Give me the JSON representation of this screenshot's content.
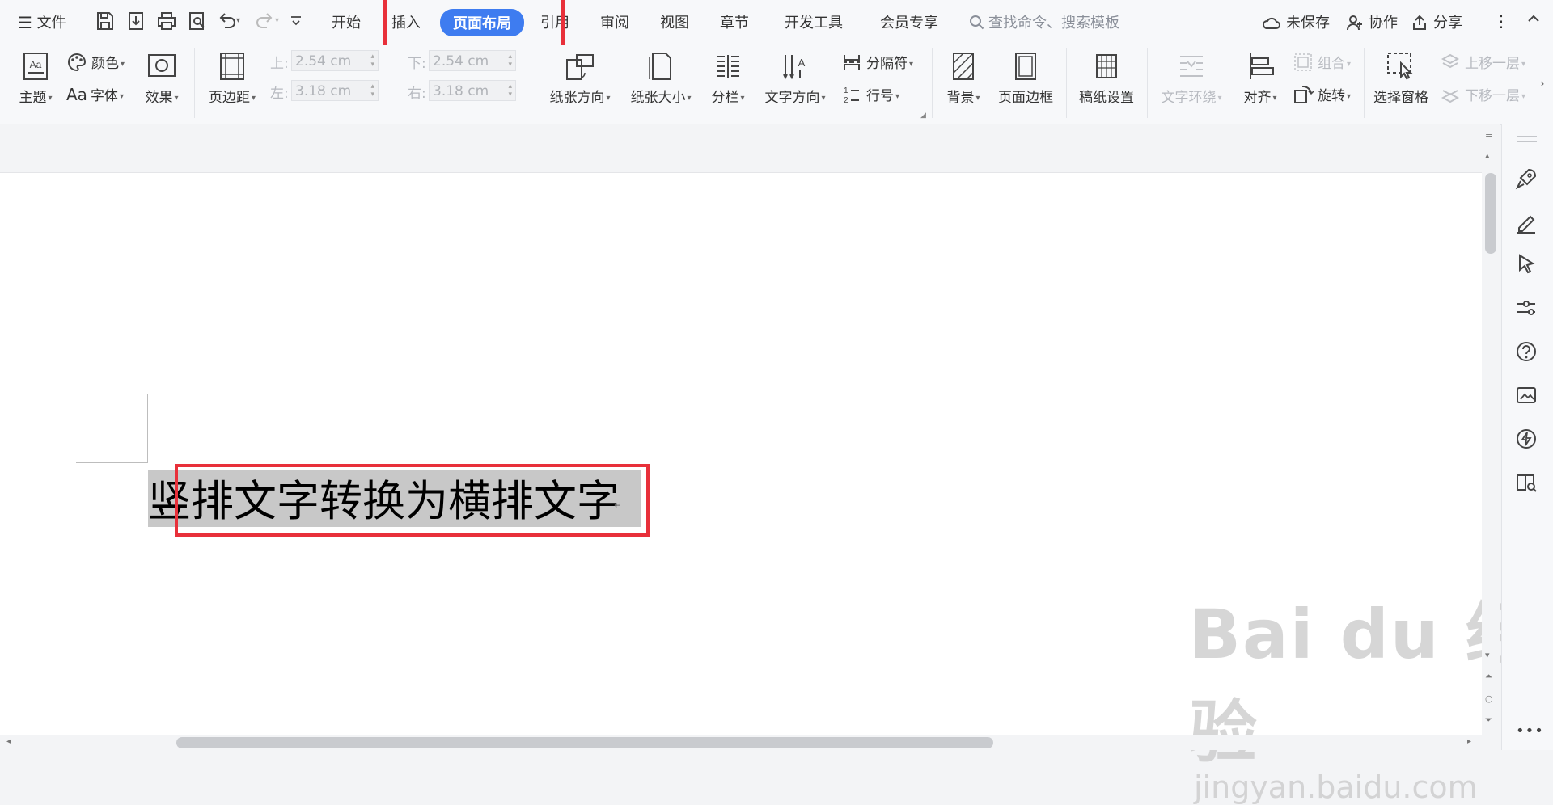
{
  "menubar": {
    "file_label": "文件",
    "tabs": [
      "开始",
      "插入",
      "页面布局",
      "引用",
      "审阅",
      "视图",
      "章节",
      "开发工具",
      "会员专享"
    ],
    "active_tab": "页面布局",
    "search_placeholder": "查找命令、搜索模板",
    "unsaved_label": "未保存",
    "collab_label": "协作",
    "share_label": "分享",
    "more_icon": "more-vertical-icon",
    "collapse_icon": "chevron-up-icon"
  },
  "ribbon": {
    "theme": "主题",
    "colors": "颜色",
    "fonts": "字体",
    "effects": "效果",
    "margins": "页边距",
    "margin_top_label": "上:",
    "margin_top_value": "2.54 cm",
    "margin_bottom_label": "下:",
    "margin_bottom_value": "2.54 cm",
    "margin_left_label": "左:",
    "margin_left_value": "3.18 cm",
    "margin_right_label": "右:",
    "margin_right_value": "3.18 cm",
    "orientation": "纸张方向",
    "size": "纸张大小",
    "columns": "分栏",
    "text_direction": "文字方向",
    "breaks": "分隔符",
    "line_numbers": "行号",
    "background": "背景",
    "page_border": "页面边框",
    "manuscript": "稿纸设置",
    "text_wrap": "文字环绕",
    "align": "对齐",
    "group": "组合",
    "rotate": "旋转",
    "selection_pane": "选择窗格",
    "bring_forward": "上移一层",
    "send_backward": "下移一层"
  },
  "document": {
    "text": "竖排文字转换为横排文字",
    "paragraph_mark": "↵"
  },
  "watermark": {
    "brand": "Bai du 经验",
    "url": "jingyan.baidu.com"
  },
  "colors": {
    "accent": "#3e7cf0",
    "highlight_box": "#e8303a",
    "selection": "#c8c8c8"
  }
}
